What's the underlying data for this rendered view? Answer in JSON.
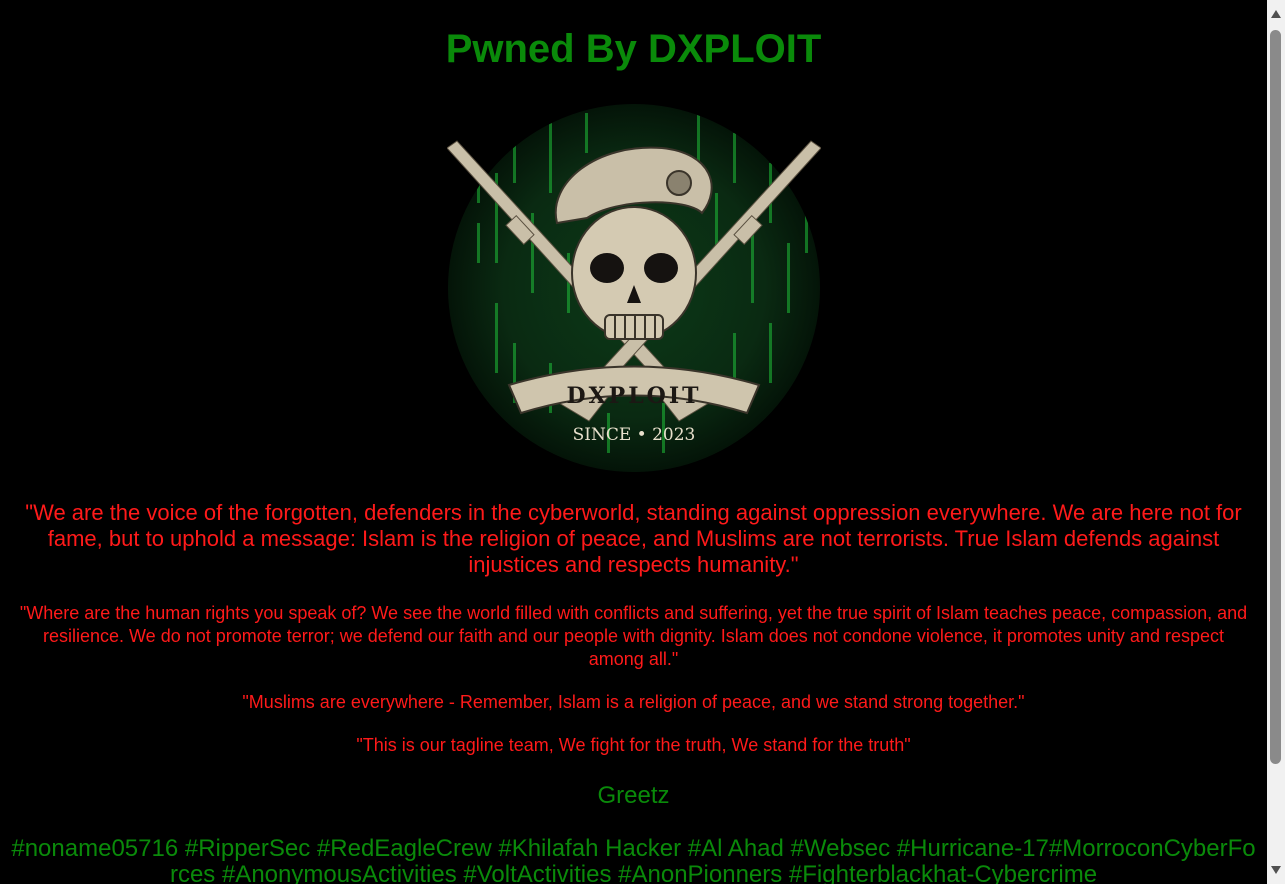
{
  "page": {
    "title": "Pwned By DXPLOIT",
    "logo": {
      "text": "DXPLOIT",
      "since": "SINCE • 2023"
    },
    "messages": [
      "\"We are the voice of the forgotten, defenders in the cyberworld, standing against oppression everywhere. We are here not for fame, but to uphold a message: Islam is the religion of peace, and Muslims are not terrorists. True Islam defends against injustices and respects humanity.\"",
      "\"Where are the human rights you speak of? We see the world filled with conflicts and suffering, yet the true spirit of Islam teaches peace, compassion, and resilience. We do not promote terror; we defend our faith and our people with dignity. Islam does not condone violence, it promotes unity and respect among all.\"",
      "\"Muslims are everywhere - Remember, Islam is a religion of peace, and we stand strong together.\"",
      "\"This is our tagline team, We fight for the truth, We stand for the truth\""
    ],
    "greetz_label": "Greetz",
    "tags": "#noname05716 #RipperSec #RedEagleCrew #Khilafah Hacker #Al Ahad #Websec #Hurricane-17#MorroconCyberForces #AnonymousActivities #VoltActivities #AnonPionners #Fighterblackhat-Cybercrime"
  },
  "colors": {
    "background": "#000000",
    "title_green": "#0a8a0a",
    "message_red": "#ff1a1a"
  },
  "icons": {
    "scroll_up": "triangle-up",
    "scroll_down": "triangle-down"
  }
}
